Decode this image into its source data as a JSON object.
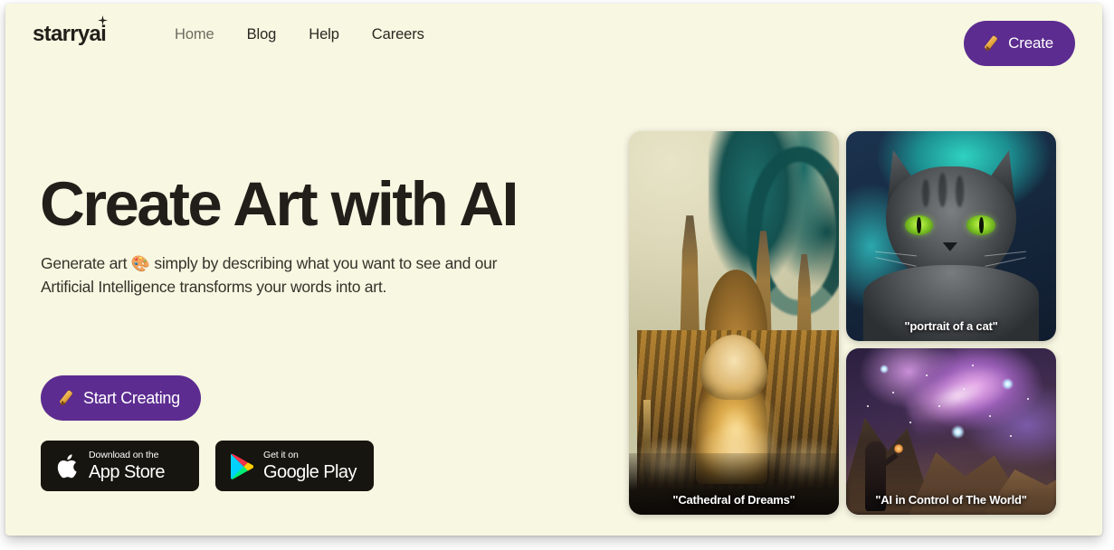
{
  "header": {
    "logo": "starryai",
    "logo_sparkle_icon": "sparkle-icon",
    "nav": [
      {
        "label": "Home",
        "active": true
      },
      {
        "label": "Blog",
        "active": false
      },
      {
        "label": "Help",
        "active": false
      },
      {
        "label": "Careers",
        "active": false
      }
    ],
    "create_button": {
      "label": "Create",
      "icon": "pencil-icon"
    }
  },
  "hero": {
    "headline": "Create Art with AI",
    "subtitle_part1": "Generate art ",
    "subtitle_emoji": "🎨",
    "subtitle_part2": " simply by describing what you want to see and our Artificial Intelligence transforms your words into art.",
    "start_button": {
      "label": "Start Creating",
      "icon": "pencil-icon"
    }
  },
  "store_badges": [
    {
      "name": "app-store",
      "icon": "apple-icon",
      "top_line": "Download on the",
      "bottom_line": "App Store"
    },
    {
      "name": "google-play",
      "icon": "google-play-icon",
      "top_line": "Get it on",
      "bottom_line": "Google Play"
    }
  ],
  "gallery": [
    {
      "name": "cathedral-of-dreams",
      "caption": "\"Cathedral of Dreams\"",
      "description": "Golden ornate gothic cathedral with teal organic forms against a cream sky"
    },
    {
      "name": "portrait-of-a-cat",
      "caption": "\"portrait of a cat\"",
      "description": "Gray tabby cat with bright green eyes on a teal and dark blue background"
    },
    {
      "name": "ai-in-control-of-the-world",
      "caption": "\"AI in Control of The World\"",
      "description": "Purple cosmic nebula over mountains with a cloaked figure holding a glowing orb"
    }
  ],
  "colors": {
    "page_background": "#F8F7E2",
    "accent_purple": "#5C2C90",
    "text_dark": "#221F1A",
    "nav_active": "#6F6B60",
    "badge_black": "#16150F"
  }
}
